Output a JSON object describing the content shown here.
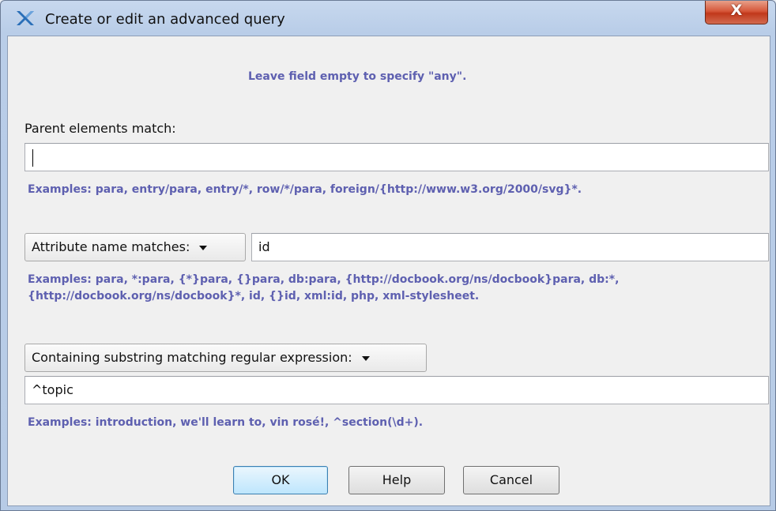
{
  "window": {
    "title": "Create or edit an advanced query",
    "close_label": "X"
  },
  "hint_top": "Leave field empty to specify \"any\".",
  "parent": {
    "label": "Parent elements match:",
    "value": "",
    "examples": "Examples: para, entry/para, entry/*, row/*/para, foreign/{http://www.w3.org/2000/svg}*."
  },
  "attribute": {
    "combo_label": "Attribute name matches:",
    "value": "id",
    "examples_line1": "Examples: para, *:para, {*}para, {}para, db:para, {http://docbook.org/ns/docbook}para, db:*,",
    "examples_line2": "{http://docbook.org/ns/docbook}*, id, {}id, xml:id, php, xml-stylesheet."
  },
  "content": {
    "combo_label": "Containing substring matching regular expression:",
    "value": "^topic",
    "examples": "Examples: introduction, we'll learn to, vin rosé!, ^section(\\d+)."
  },
  "buttons": {
    "ok": "OK",
    "help": "Help",
    "cancel": "Cancel"
  }
}
